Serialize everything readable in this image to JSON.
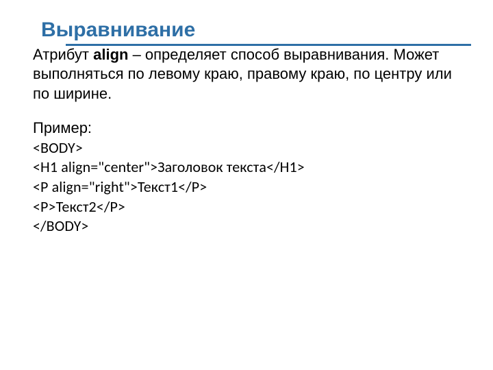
{
  "title": "Выравнивание",
  "para1_pre": "Атрибут ",
  "para1_bold": "align",
  "para1_post": " – определяет способ выравнивания. Может выполняться по левому краю, правому краю, по центру или по ширине.",
  "example_label": "Пример:",
  "code1": "<BODY>",
  "code2": "<H1  align=\"center\">Заголовок текста</H1>",
  "code3": "<P  align=\"right\">Текст1</P>",
  "code4": "<P>Текст2</P>",
  "code5": "</BODY>"
}
